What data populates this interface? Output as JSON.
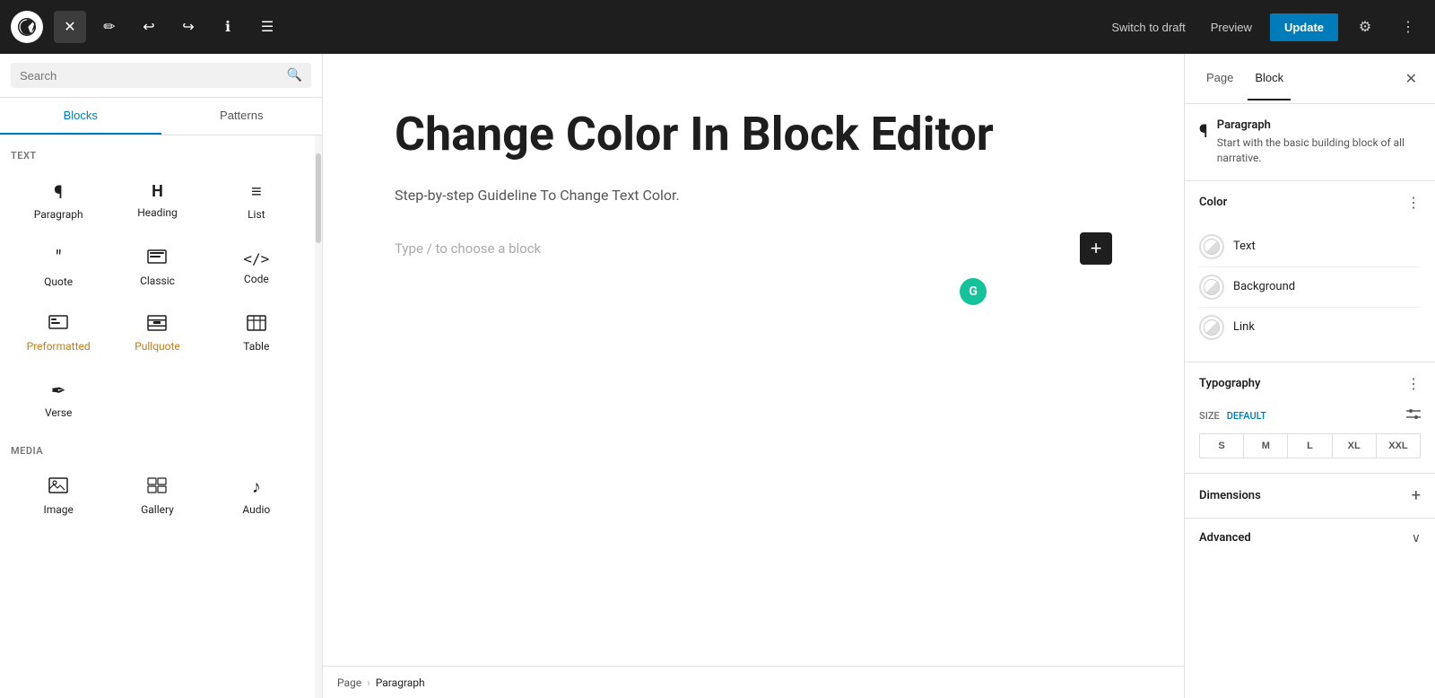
{
  "toolbar": {
    "wp_logo_alt": "WordPress",
    "close_label": "✕",
    "edit_icon": "✏",
    "undo_icon": "↩",
    "redo_icon": "↪",
    "info_icon": "ℹ",
    "list_icon": "☰",
    "switch_to_draft": "Switch to draft",
    "preview": "Preview",
    "update": "Update",
    "settings_icon": "⚙",
    "kebab_icon": "⋮"
  },
  "left_sidebar": {
    "search_placeholder": "Search",
    "tab_blocks": "Blocks",
    "tab_patterns": "Patterns",
    "section_text": "TEXT",
    "section_media": "MEDIA",
    "blocks_text": [
      {
        "icon": "¶",
        "label": "Paragraph"
      },
      {
        "icon": "🔖",
        "label": "Heading"
      },
      {
        "icon": "≡",
        "label": "List"
      },
      {
        "icon": "❝",
        "label": "Quote"
      },
      {
        "icon": "⌨",
        "label": "Classic"
      },
      {
        "icon": "<>",
        "label": "Code"
      },
      {
        "icon": "⊞",
        "label": "Preformatted",
        "colored": true
      },
      {
        "icon": "▤",
        "label": "Pullquote",
        "colored": true
      },
      {
        "icon": "⊟",
        "label": "Table"
      },
      {
        "icon": "✒",
        "label": "Verse"
      }
    ],
    "blocks_media": [
      {
        "icon": "🖼",
        "label": "Image"
      },
      {
        "icon": "⊡",
        "label": "Gallery"
      },
      {
        "icon": "♪",
        "label": "Audio"
      }
    ]
  },
  "editor": {
    "post_title": "Change Color In Block Editor",
    "post_subtitle": "Step-by-step Guideline To Change Text Color.",
    "type_placeholder": "Type / to choose a block",
    "add_block_label": "+",
    "grammarly_label": "G"
  },
  "breadcrumb": {
    "page": "Page",
    "separator": "›",
    "paragraph": "Paragraph"
  },
  "right_sidebar": {
    "tab_page": "Page",
    "tab_block": "Block",
    "close_icon": "✕",
    "block_info": {
      "icon": "¶",
      "title": "Paragraph",
      "description": "Start with the basic building block of all narrative."
    },
    "color_section": {
      "title": "Color",
      "more_icon": "⋮",
      "items": [
        {
          "label": "Text"
        },
        {
          "label": "Background"
        },
        {
          "label": "Link"
        }
      ]
    },
    "typography_section": {
      "title": "Typography",
      "more_icon": "⋮",
      "size_label": "SIZE",
      "size_value": "DEFAULT",
      "slider_icon": "⊞",
      "sizes": [
        "S",
        "M",
        "L",
        "XL",
        "XXL"
      ]
    },
    "dimensions_section": {
      "title": "Dimensions",
      "add_icon": "+"
    },
    "advanced_section": {
      "title": "Advanced",
      "chevron": "∨"
    }
  }
}
